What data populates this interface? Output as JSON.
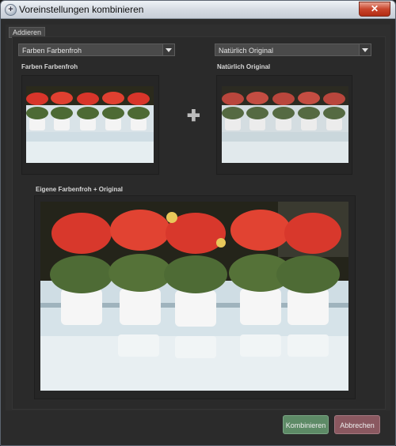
{
  "window": {
    "title": "Voreinstellungen kombinieren",
    "close_glyph": "✕"
  },
  "tab": {
    "label": "Addieren"
  },
  "left": {
    "dropdown_value": "Farben Farbenfroh",
    "preview_label": "Farben Farbenfroh"
  },
  "right": {
    "dropdown_value": "Natürlich Original",
    "preview_label": "Natürlich Original"
  },
  "combined": {
    "label": "Eigene Farbenfroh + Original"
  },
  "operator": "✚",
  "buttons": {
    "combine": "Kombinieren",
    "cancel": "Abbrechen"
  },
  "colors": {
    "combine_button": "#5d8a66",
    "cancel_button": "#8a5860",
    "panel": "#2f2f2f"
  },
  "icons": {
    "title": "plus-circle-icon",
    "close": "close-icon",
    "dropdown": "chevron-down-icon"
  }
}
